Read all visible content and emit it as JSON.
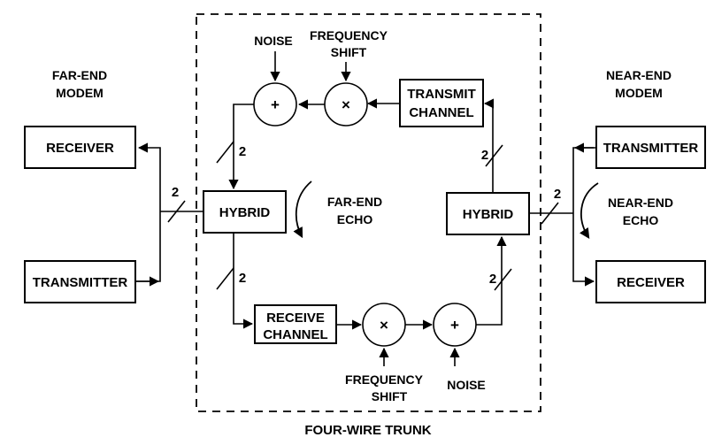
{
  "diagram": {
    "title": "FOUR-WIRE TRUNK",
    "boundary_label": "FOUR-WIRE TRUNK",
    "groups": {
      "far_end_modem": "FAR-END\nMODEM",
      "far_end_modem_line1": "FAR-END",
      "far_end_modem_line2": "MODEM",
      "near_end_modem_line1": "NEAR-END",
      "near_end_modem_line2": "MODEM"
    },
    "blocks": {
      "far_receiver": "RECEIVER",
      "far_transmitter": "TRANSMITTER",
      "near_transmitter": "TRANSMITTER",
      "near_receiver": "RECEIVER",
      "far_hybrid": "HYBRID",
      "near_hybrid": "HYBRID",
      "transmit_channel_line1": "TRANSMIT",
      "transmit_channel_line2": "CHANNEL",
      "receive_channel_line1": "RECEIVE",
      "receive_channel_line2": "CHANNEL"
    },
    "operators": {
      "top_sum": "+",
      "top_mult": "×",
      "bottom_mult": "×",
      "bottom_sum": "+"
    },
    "impairments": {
      "top_noise": "NOISE",
      "top_freq_shift_line1": "FREQUENCY",
      "top_freq_shift_line2": "SHIFT",
      "bottom_freq_shift_line1": "FREQUENCY",
      "bottom_freq_shift_line2": "SHIFT",
      "bottom_noise": "NOISE"
    },
    "echoes": {
      "far_end_echo_line1": "FAR-END",
      "far_end_echo_line2": "ECHO",
      "near_end_echo_line1": "NEAR-END",
      "near_end_echo_line2": "ECHO"
    },
    "bus_widths": {
      "far_modem_bus": "2",
      "far_hybrid_up": "2",
      "far_hybrid_down": "2",
      "near_hybrid_up": "2",
      "near_hybrid_down": "2",
      "near_modem_bus": "2"
    },
    "colors": {
      "stroke": "#000000",
      "background": "#ffffff",
      "text": "#000000"
    }
  }
}
